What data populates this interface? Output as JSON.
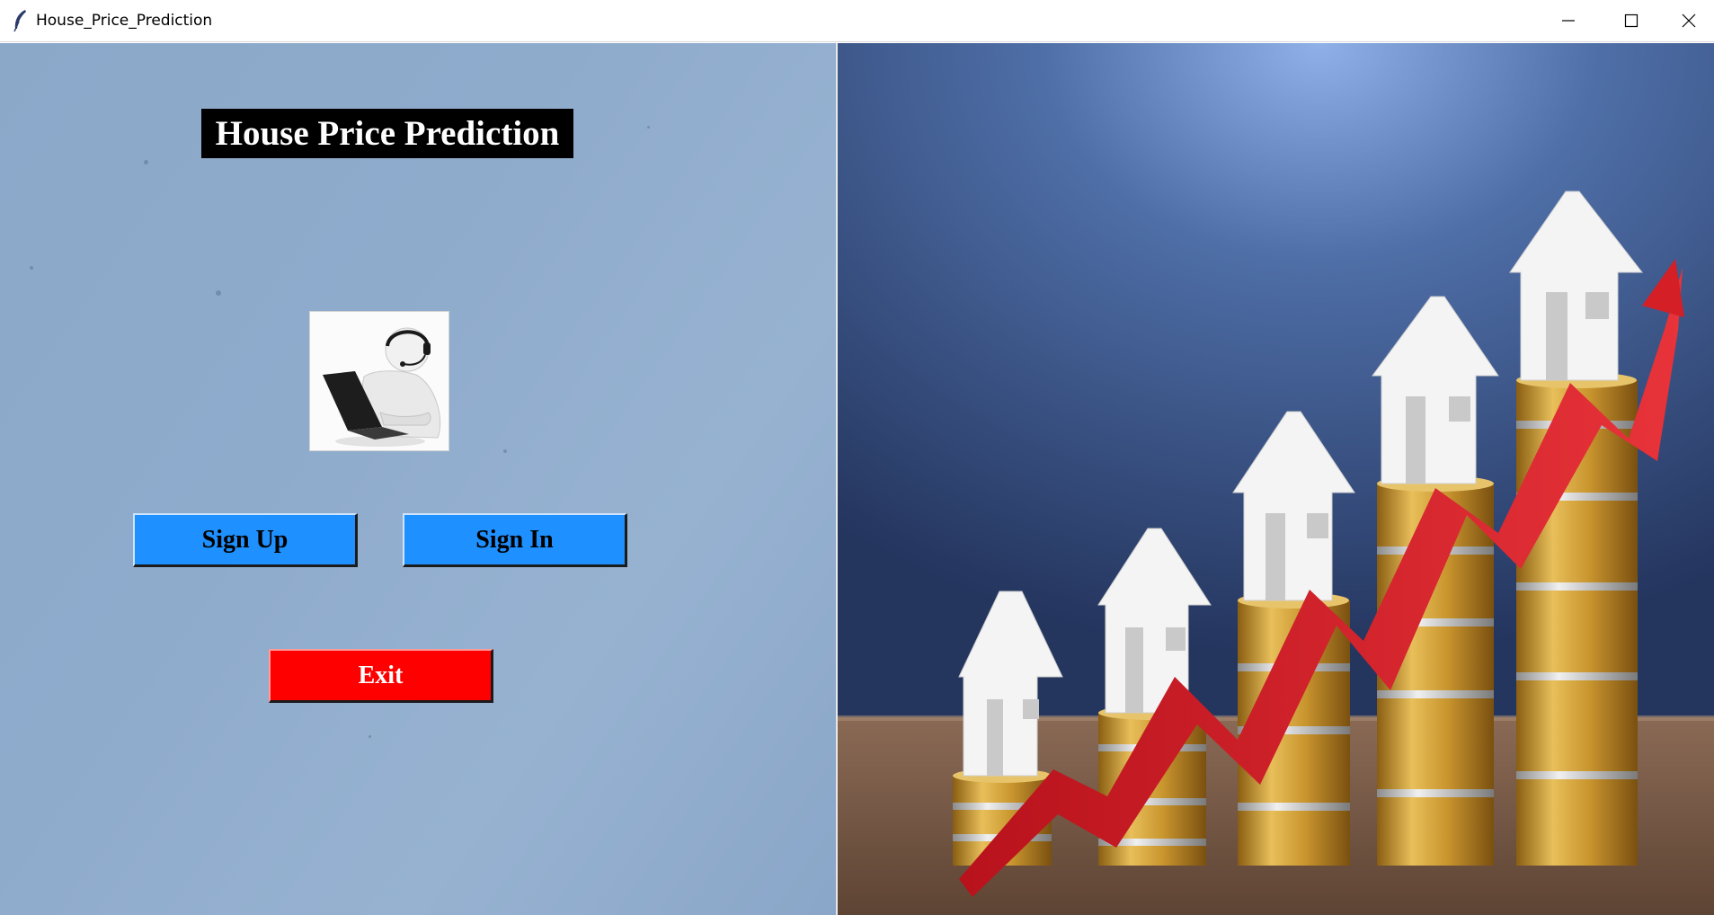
{
  "window": {
    "title": "House_Price_Prediction",
    "app_icon": "feather-icon",
    "controls": [
      "minimize-icon",
      "maximize-icon",
      "close-icon"
    ]
  },
  "main": {
    "heading": "House Price Prediction",
    "avatar_icon": "user-laptop-headset-icon",
    "buttons": {
      "sign_up": "Sign Up",
      "sign_in": "Sign In",
      "exit": "Exit"
    }
  },
  "illustration": {
    "description_icon": "house-price-growth-illustration"
  },
  "colors": {
    "primary_button": "#1e90ff",
    "exit_button": "#ff0000",
    "title_bg": "#000000",
    "left_bg": "#8ca8c9"
  }
}
